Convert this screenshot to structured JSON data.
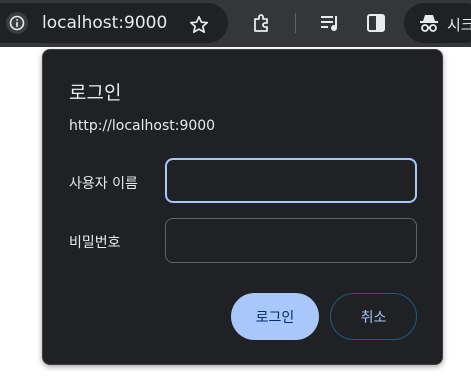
{
  "browser": {
    "url": "localhost:9000",
    "profile_label": "시크"
  },
  "dialog": {
    "title": "로그인",
    "origin": "http://localhost:9000",
    "username_label": "사용자 이름",
    "username_value": "",
    "password_label": "비밀번호",
    "password_value": "",
    "login_button": "로그인",
    "cancel_button": "취소"
  },
  "colors": {
    "toolbar": "#35363a",
    "dialog_bg": "#202124",
    "primary_button": "#a8c7fa",
    "focus_ring": "#a8c7fa"
  },
  "icons": [
    "info-icon",
    "star-icon",
    "extensions-icon",
    "media-controls-icon",
    "side-panel-icon",
    "incognito-icon"
  ]
}
